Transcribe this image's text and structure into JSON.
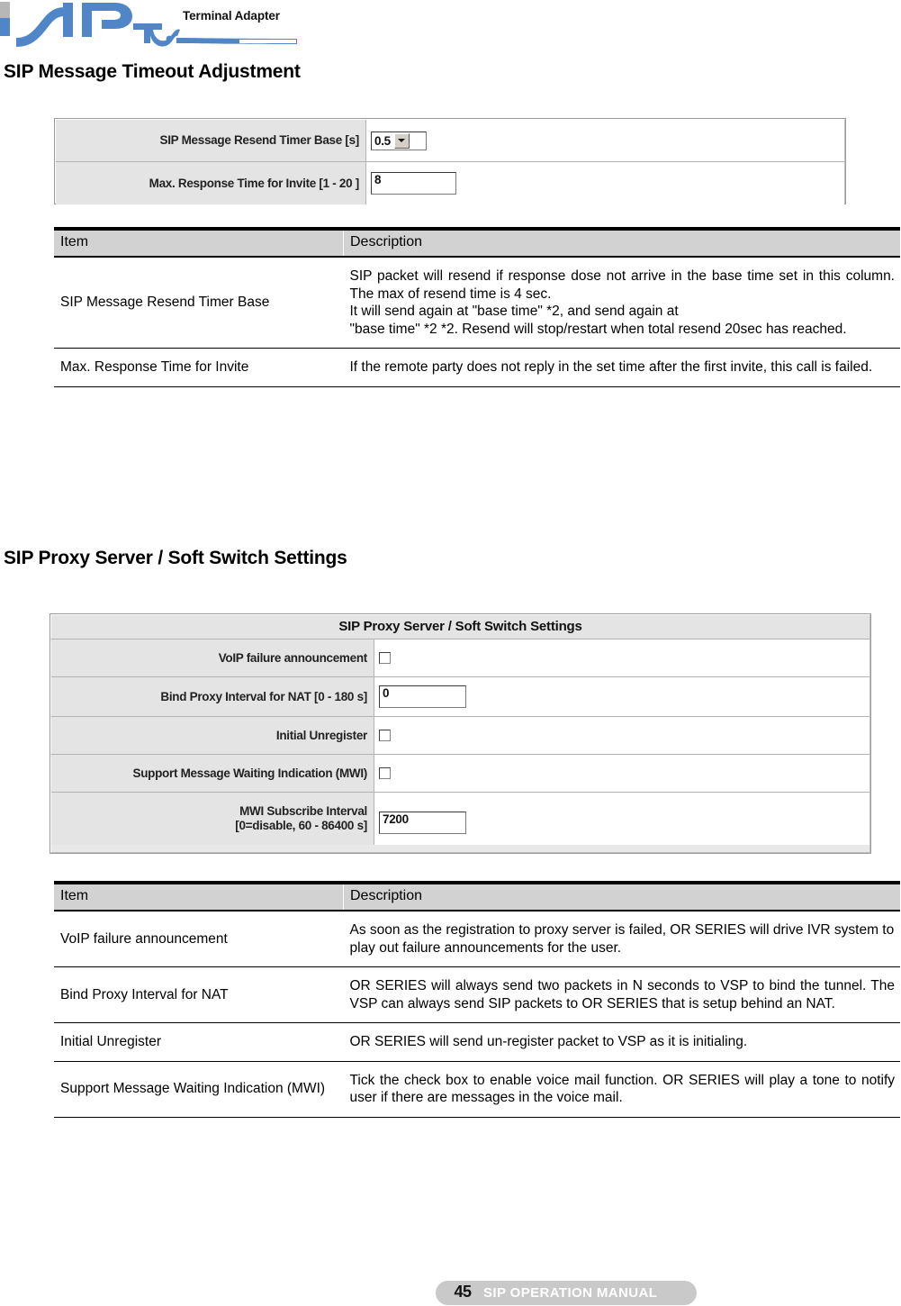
{
  "header": {
    "logo_alt": "SIP TA logo",
    "product_label": "Terminal Adapter",
    "logo_color": "#5085C8"
  },
  "sections": [
    {
      "heading": "SIP Message Timeout Adjustment",
      "panel": {
        "title": "",
        "rows": [
          {
            "label": "SIP Message Resend Timer Base [s]",
            "widget": "select",
            "value": "0.5"
          },
          {
            "label": "Max. Response Time for Invite [1 - 20 ]",
            "widget": "text",
            "value": "8"
          }
        ]
      },
      "table": {
        "columns": [
          "Item",
          "Description"
        ],
        "rows": [
          {
            "item": "SIP Message Resend Timer Base",
            "description": "SIP packet will resend if response dose not arrive in the base time set in this column. The max of resend time is 4 sec.\nIt will send again at \"base time\" *2, and send again at\n\"base time\" *2 *2. Resend will stop/restart when total resend 20sec has reached."
          },
          {
            "item": "Max. Response Time for Invite",
            "description": "If the remote party does not reply in the set time after the first invite, this call is failed."
          }
        ]
      }
    },
    {
      "heading": "SIP Proxy Server / Soft Switch Settings",
      "panel": {
        "title": "SIP Proxy Server / Soft Switch Settings",
        "rows": [
          {
            "label": "VoIP failure announcement",
            "widget": "checkbox",
            "value": "unchecked"
          },
          {
            "label": "Bind Proxy Interval for NAT [0 - 180 s]",
            "widget": "text",
            "value": "0"
          },
          {
            "label": "Initial Unregister",
            "widget": "checkbox",
            "value": "unchecked"
          },
          {
            "label": "Support Message Waiting Indication (MWI)",
            "widget": "checkbox",
            "value": "unchecked"
          },
          {
            "label": "MWI Subscribe Interval\n[0=disable, 60 - 86400 s]",
            "widget": "text",
            "value": "7200"
          }
        ]
      },
      "table": {
        "columns": [
          "Item",
          "Description"
        ],
        "rows": [
          {
            "item": "VoIP failure announcement",
            "description": "As soon as the registration to proxy server is failed, OR SERIES will drive IVR system to play out failure announcements for the user."
          },
          {
            "item": "Bind Proxy Interval for NAT",
            "description": "OR SERIES will always send two packets in N seconds to VSP to bind the tunnel. The VSP can always send SIP packets to OR SERIES that is setup behind an NAT."
          },
          {
            "item": "Initial Unregister",
            "description": "OR SERIES will send un-register packet to VSP as it is initialing."
          },
          {
            "item": "Support Message Waiting Indication (MWI)",
            "description": "Tick the check box to enable voice mail function. OR SERIES will play a tone to notify user if there are messages in the voice mail."
          }
        ]
      }
    }
  ],
  "footer": {
    "page_number": "45",
    "manual_title": "SIP OPERATION MANUAL"
  }
}
